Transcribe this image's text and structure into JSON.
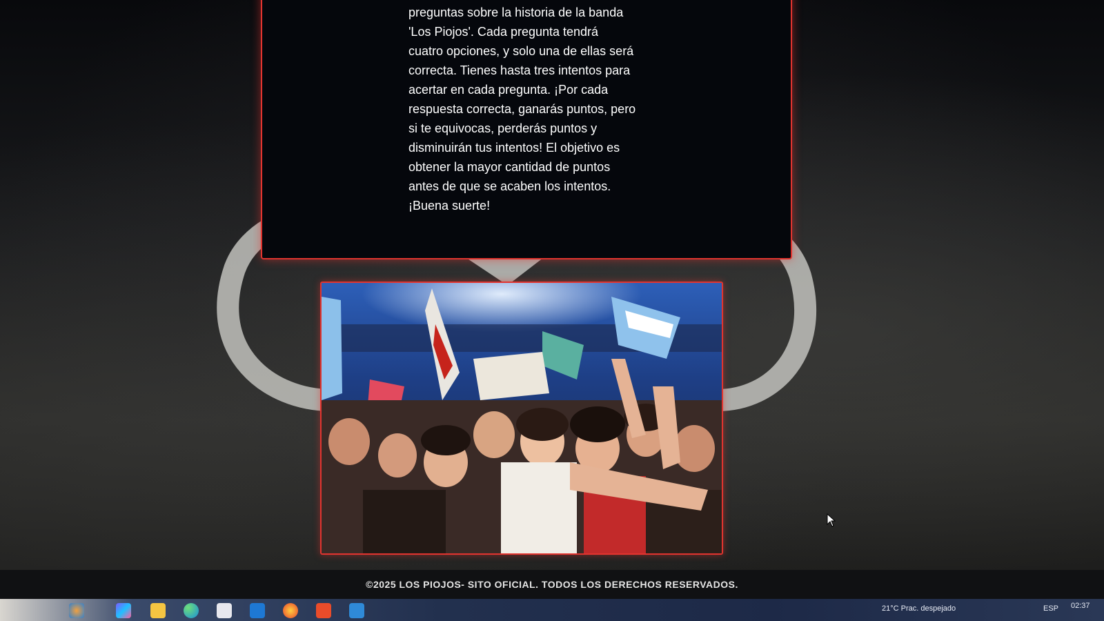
{
  "info": {
    "lines": [
      "preguntas sobre la historia de la banda",
      "'Los Piojos'. Cada pregunta tendrá",
      "cuatro opciones, y solo una de ellas será",
      "correcta. Tienes hasta tres intentos para",
      "acertar en cada pregunta. ¡Por cada",
      "respuesta correcta, ganarás puntos, pero",
      "si te equivocas, perderás puntos y",
      "disminuirán tus intentos! El objetivo es",
      "obtener la mayor cantidad de puntos",
      "antes de que se acaben los intentos.",
      "¡Buena suerte!"
    ]
  },
  "footer": {
    "copyright": "©2025 LOS PIOJOS- SITO OFICIAL. TODOS LOS DERECHOS RESERVADOS."
  },
  "taskbar": {
    "weather": "21°C  Prac. despejado",
    "language": "ESP",
    "time": "02:37",
    "apps": [
      "start-icon",
      "copilot-icon",
      "file-explorer-icon",
      "edge-icon",
      "store-icon",
      "outlook-icon",
      "firefox-icon",
      "brave-icon",
      "vscode-icon"
    ]
  },
  "colors": {
    "accent_red": "#e2342f",
    "card_bg": "#05070c",
    "footer_bg": "#101113"
  }
}
